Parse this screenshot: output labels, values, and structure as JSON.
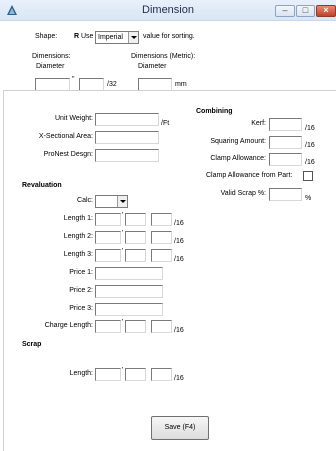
{
  "window": {
    "title": "Dimension"
  },
  "top": {
    "shape_label": "Shape:",
    "shape_value": "R",
    "use_label": "Use",
    "units_selected": "Imperial",
    "sort_text": "value for sorting.",
    "dimensions_label": "Dimensions:",
    "diameter_label": "Diameter",
    "dimensions_metric_label": "Dimensions (Metric):",
    "diameter_metric_label": "Diameter",
    "inch_mark": "\"",
    "fraction_unit": "/32",
    "mm_unit": "mm"
  },
  "general": {
    "unit_weight_label": "Unit Weight:",
    "unit_weight_unit": "/Ft",
    "xsection_label": "X-Sectional Area:",
    "pronest_label": "ProNest Desgn:"
  },
  "combining": {
    "heading": "Combining",
    "kerf_label": "Kerf:",
    "squaring_label": "Squaring Amount:",
    "clamp_label": "Clamp Allowance:",
    "clamp_from_part_label": "Clamp Allowance from Part:",
    "valid_scrap_label": "Valid Scrap %:",
    "unit_16": "/16",
    "percent_unit": "%"
  },
  "revaluation": {
    "heading": "Revaluation",
    "calc_label": "Calc:",
    "length1_label": "Length 1:",
    "length2_label": "Length 2:",
    "length3_label": "Length 3:",
    "price1_label": "Price 1:",
    "price2_label": "Price 2:",
    "price3_label": "Price 3:",
    "charge_length_label": "Charge Length:",
    "unit_16": "/16",
    "tick": "'"
  },
  "scrap": {
    "heading": "Scrap",
    "length_label": "Length:"
  },
  "actions": {
    "save_label": "Save (F4)"
  },
  "colors": {
    "titlebar": "#d9e6f5",
    "close_button": "#c2412a"
  }
}
